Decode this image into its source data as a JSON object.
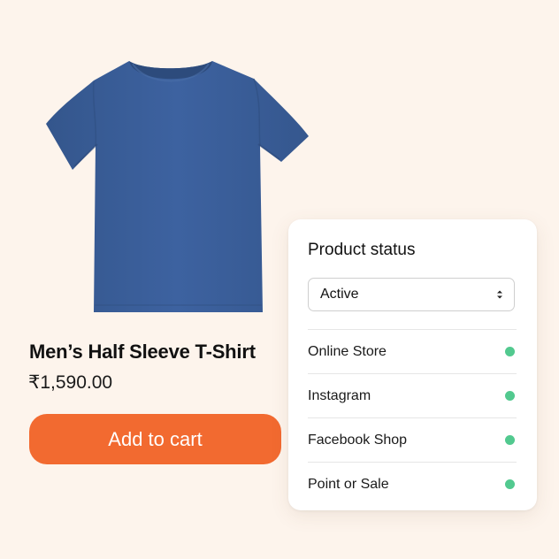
{
  "product": {
    "name": "Men’s Half Sleeve T-Shirt",
    "price": "₹1,590.00",
    "image_icon": "tshirt-icon",
    "image_color": "#3b5f97",
    "add_to_cart_label": "Add to cart",
    "button_color": "#f26a30"
  },
  "status_panel": {
    "title": "Product status",
    "selected_status": "Active",
    "select_icon": "sort-arrows-icon",
    "channels": [
      {
        "label": "Online Store",
        "status_color": "#52c98f"
      },
      {
        "label": "Instagram",
        "status_color": "#52c98f"
      },
      {
        "label": "Facebook Shop",
        "status_color": "#52c98f"
      },
      {
        "label": "Point or Sale",
        "status_color": "#52c98f"
      }
    ]
  },
  "colors": {
    "background": "#fdf4ec",
    "card": "#ffffff",
    "active_dot": "#52c98f"
  }
}
